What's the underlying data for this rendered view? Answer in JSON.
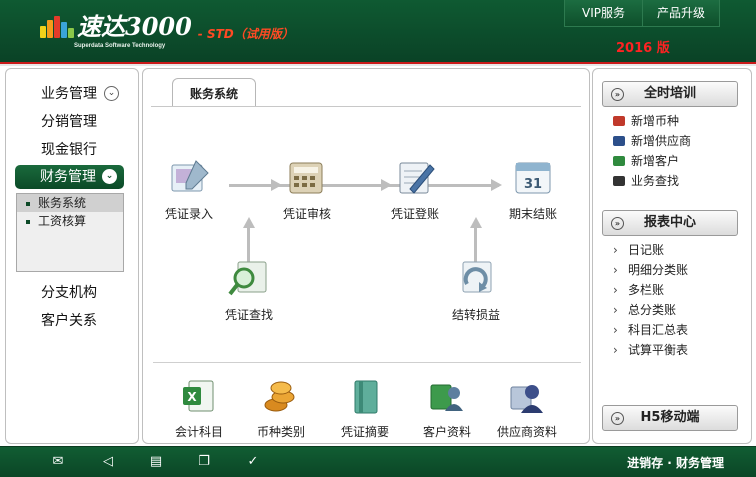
{
  "header": {
    "logo_name": "速达3000",
    "logo_edition": "- STD（试用版）",
    "logo_subtitle": "Superdata Software Technology",
    "buttons": [
      "VIP服务",
      "产品升级"
    ],
    "year_label": "2016 版"
  },
  "sidebar": {
    "items": [
      {
        "label": "业务管理",
        "expand": "⌄"
      },
      {
        "label": "分销管理"
      },
      {
        "label": "现金银行"
      },
      {
        "label": "财务管理",
        "expand": "⌄"
      },
      {
        "label": "分支机构"
      },
      {
        "label": "客户关系"
      }
    ],
    "submenu": [
      "账务系统",
      "工资核算"
    ]
  },
  "main": {
    "tab": "账务系统",
    "flow": {
      "entry": "凭证录入",
      "audit": "凭证审核",
      "post": "凭证登账",
      "close": "期末结账",
      "search": "凭证查找",
      "transfer": "结转损益"
    },
    "tools": [
      "会计科目",
      "币种类别",
      "凭证摘要",
      "客户资料",
      "供应商资料"
    ]
  },
  "right": {
    "training_title": "全时培训",
    "training_items": [
      "新增币种",
      "新增供应商",
      "新增客户",
      "业务查找"
    ],
    "reports_title": "报表中心",
    "reports_items": [
      "日记账",
      "明细分类账",
      "多栏账",
      "总分类账",
      "科目汇总表",
      "试算平衡表"
    ],
    "mobile_title": "H5移动端"
  },
  "footer": {
    "text": "进销存 · 财务管理",
    "icons": [
      "mail-icon",
      "speaker-icon",
      "book-icon",
      "window-icon",
      "check-circle-icon"
    ]
  },
  "colors": {
    "header_green": "#0f5a32",
    "accent_red": "#c91a1a",
    "year_red": "#ff2222"
  }
}
